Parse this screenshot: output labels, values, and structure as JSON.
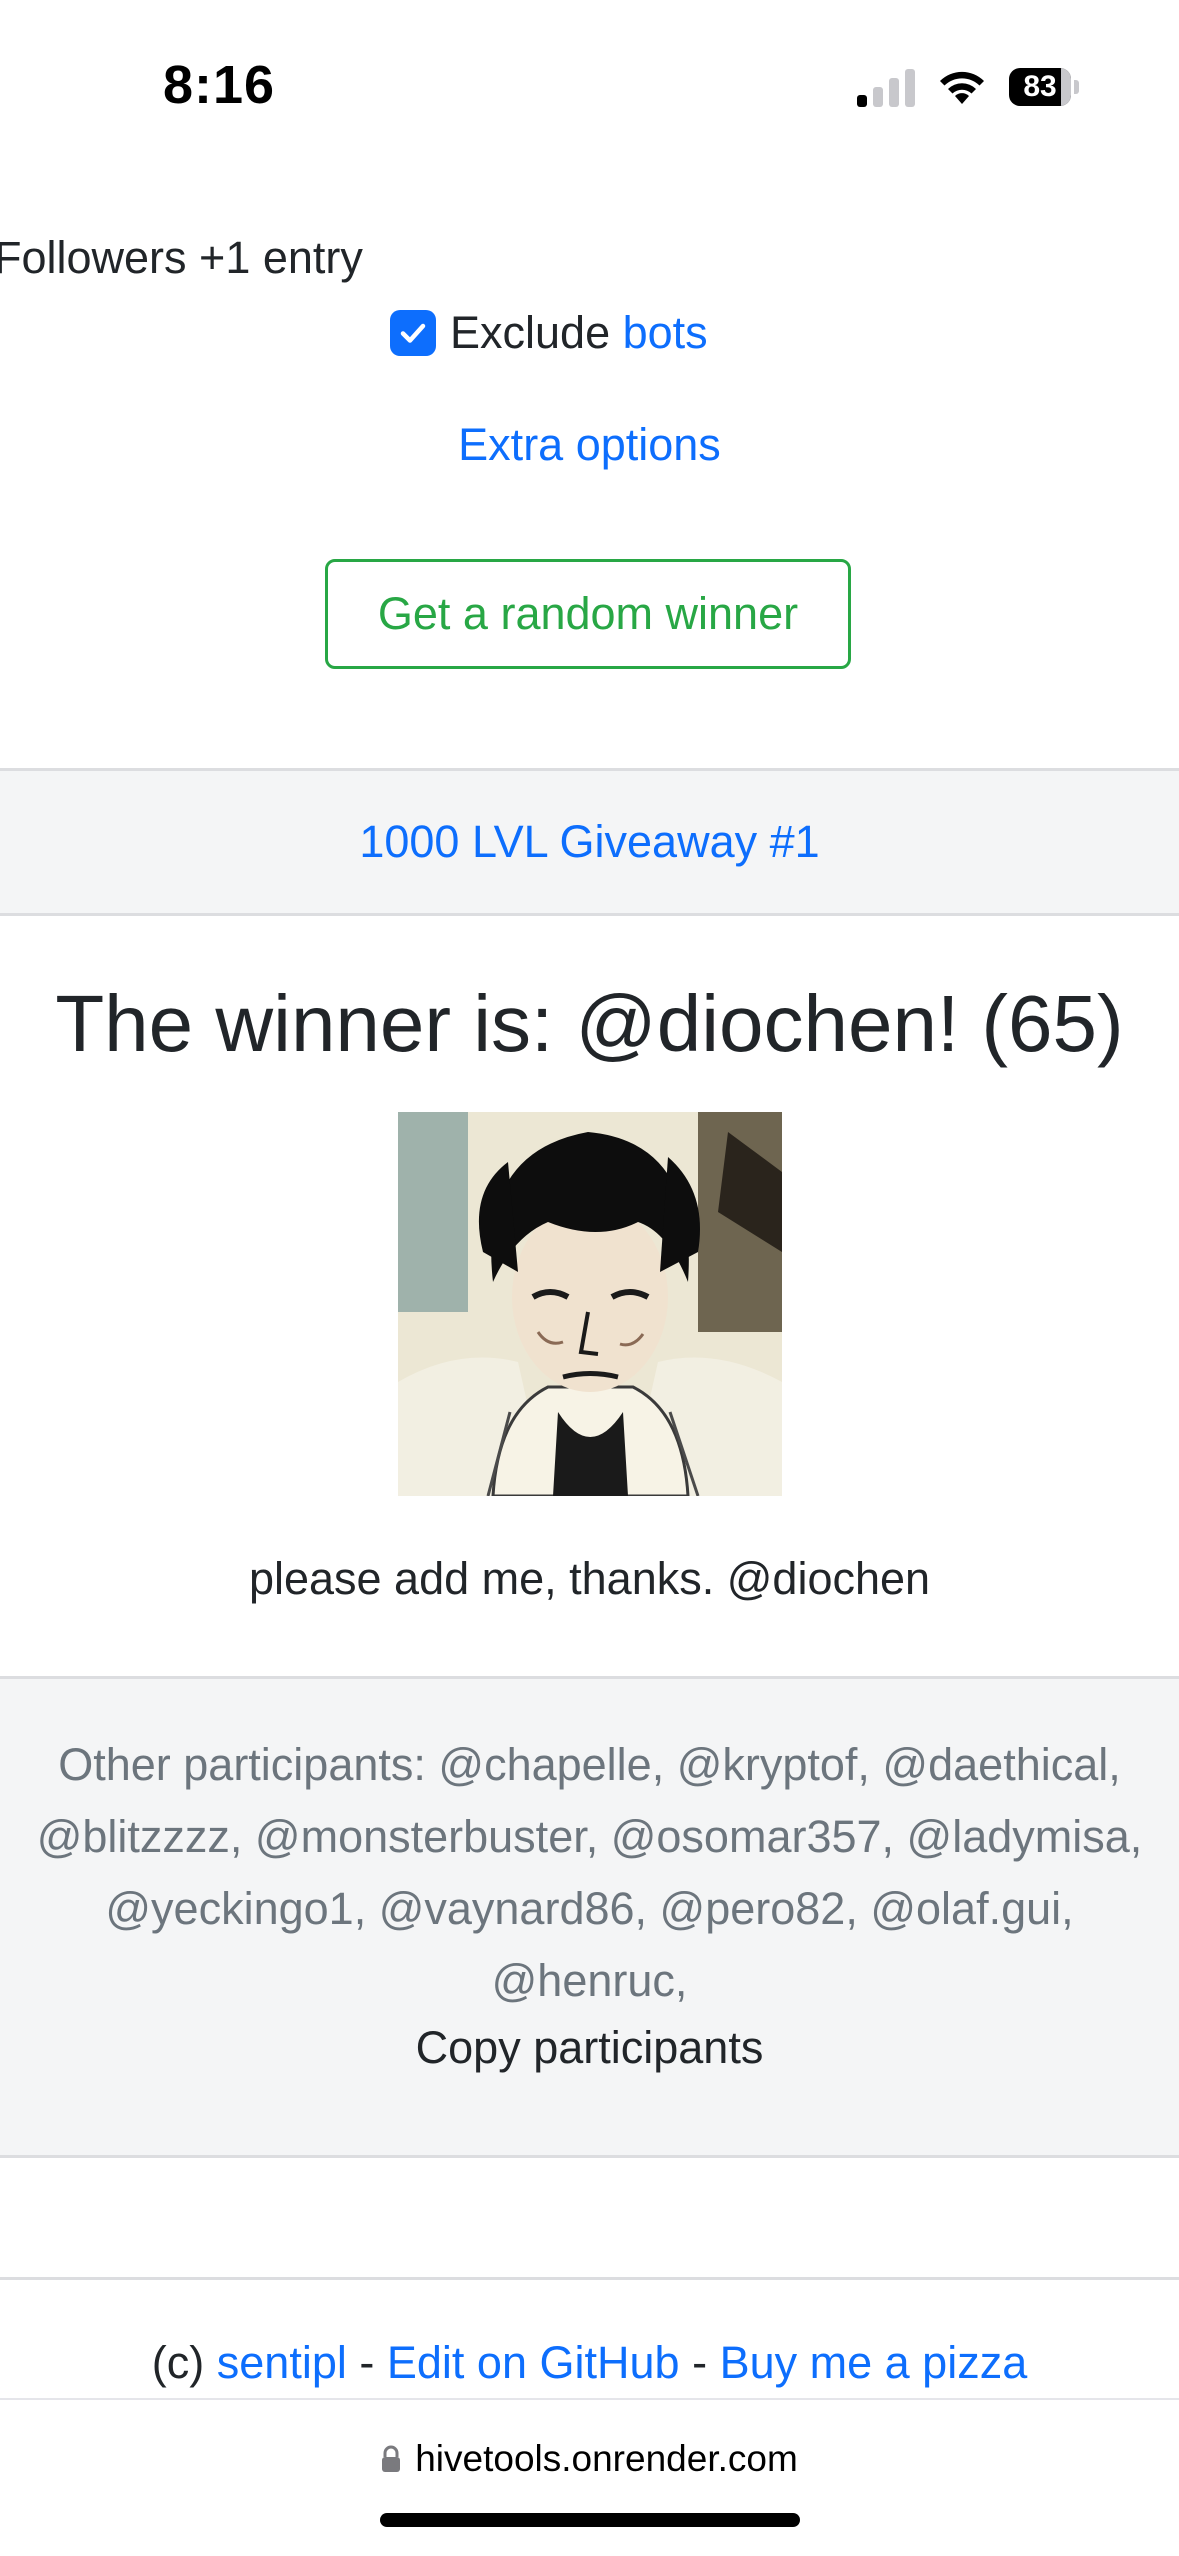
{
  "status_bar": {
    "time": "8:16",
    "battery": "83",
    "icons": [
      "cellular-signal-icon",
      "wifi-icon",
      "battery-icon"
    ]
  },
  "form": {
    "followers_text": "Followers +1 entry",
    "exclude_label": "Exclude",
    "exclude_link": "bots",
    "exclude_checked": true,
    "extra_options": "Extra options",
    "winner_button": "Get a random winner"
  },
  "giveaway": {
    "title": "1000 LVL Giveaway #1"
  },
  "result": {
    "winner_text": "The winner is: @diochen! (65)",
    "comment": "please add me, thanks. @diochen"
  },
  "participants": {
    "text": "Other participants: @chapelle, @kryptof, @daethical, @blitzzzz, @monsterbuster, @osomar357, @ladymisa, @yeckingo1, @vaynard86, @pero82, @olaf.gui, @henruc,",
    "copy_label": "Copy participants"
  },
  "footer": {
    "prefix": "(c)",
    "author": "sentipl",
    "separator": "-",
    "github": "Edit on GitHub",
    "pizza": "Buy me a pizza"
  },
  "browser": {
    "url": "hivetools.onrender.com"
  },
  "colors": {
    "link": "#0d6efd",
    "success": "#28a745",
    "muted": "#6c757d",
    "band": "#f4f5f6"
  }
}
